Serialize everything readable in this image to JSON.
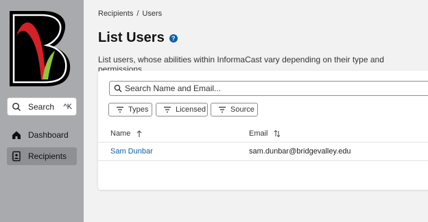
{
  "sidebar": {
    "logo_letter": "B",
    "search_label": "Search",
    "search_shortcut": "^K",
    "nav": [
      {
        "label": "Dashboard",
        "icon": "home-icon"
      },
      {
        "label": "Recipients",
        "icon": "contacts-icon",
        "active": true
      }
    ]
  },
  "breadcrumb": {
    "items": [
      "Recipients",
      "Users"
    ],
    "separator": "/"
  },
  "page": {
    "title": "List Users",
    "help_icon": "?",
    "subtitle": "List users, whose abilities within InformaCast vary depending on their type and permissions."
  },
  "search": {
    "placeholder": "Search Name and Email..."
  },
  "filters": [
    {
      "label": "Types",
      "icon": "filter-icon"
    },
    {
      "label": "Licensed",
      "icon": "filter-icon"
    },
    {
      "label": "Source",
      "icon": "filter-icon"
    }
  ],
  "table": {
    "columns": [
      {
        "label": "Name",
        "sort_icon": "arrow-up-icon"
      },
      {
        "label": "Email",
        "sort_icon": "sort-both-icon"
      }
    ],
    "rows": [
      {
        "name": "Sam Dunbar",
        "email": "sam.dunbar@bridgevalley.edu"
      }
    ]
  },
  "colors": {
    "sidebar_bg": "#a9aaad",
    "active_nav": "#8f9094",
    "link": "#0b5ea8",
    "logo_red": "#d42027",
    "logo_green": "#8dc63f"
  }
}
